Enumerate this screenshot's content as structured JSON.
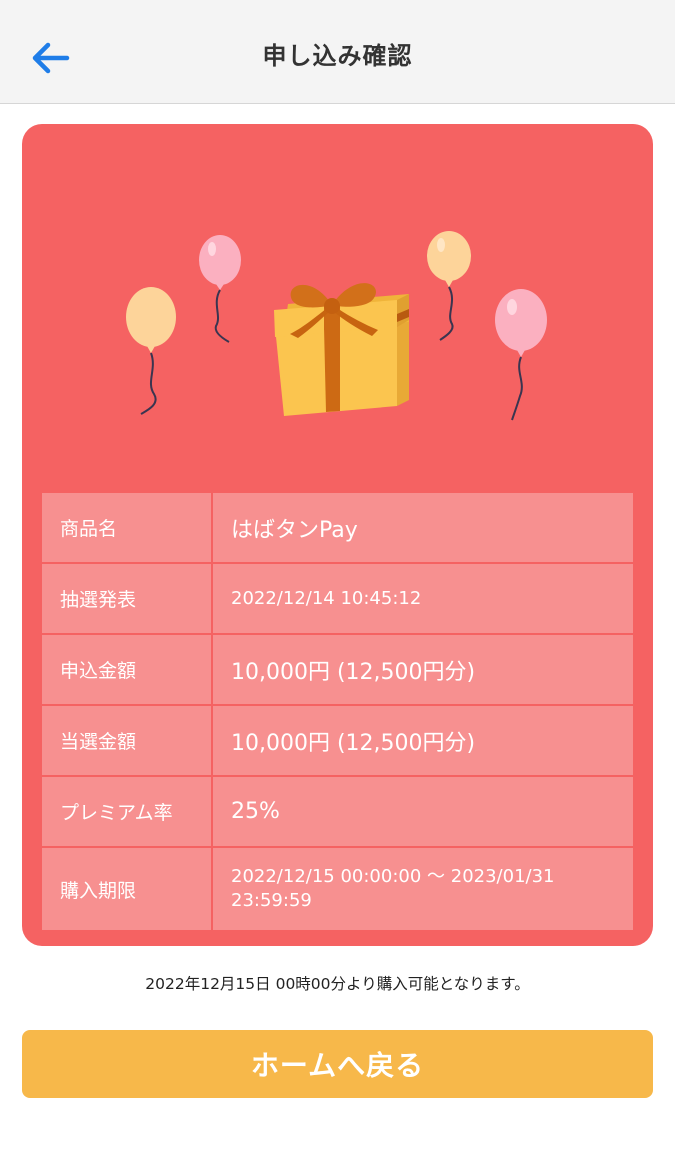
{
  "header": {
    "title": "申し込み確認",
    "back_icon": "arrow-left-icon"
  },
  "colors": {
    "accent_blue": "#1f7de8",
    "card_bg": "#f56262",
    "table_cell_bg": "#f79090",
    "button_bg": "#f7b84a",
    "header_bg": "#f4f4f4"
  },
  "card": {
    "illustration_icons": [
      "balloon-icon",
      "gift-box-icon"
    ],
    "rows": [
      {
        "label": "商品名",
        "value": "はばタンPay"
      },
      {
        "label": "抽選発表",
        "value": "2022/12/14 10:45:12"
      },
      {
        "label": "申込金額",
        "value": "10,000円 (12,500円分)"
      },
      {
        "label": "当選金額",
        "value": "10,000円 (12,500円分)"
      },
      {
        "label": "プレミアム率",
        "value": "25%"
      },
      {
        "label": "購入期限",
        "value": "2022/12/15 00:00:00 ～ 2023/01/31 23:59:59"
      }
    ]
  },
  "notice": "2022年12月15日 00時00分より購入可能となります。",
  "home_button": {
    "label": "ホームへ戻る"
  }
}
